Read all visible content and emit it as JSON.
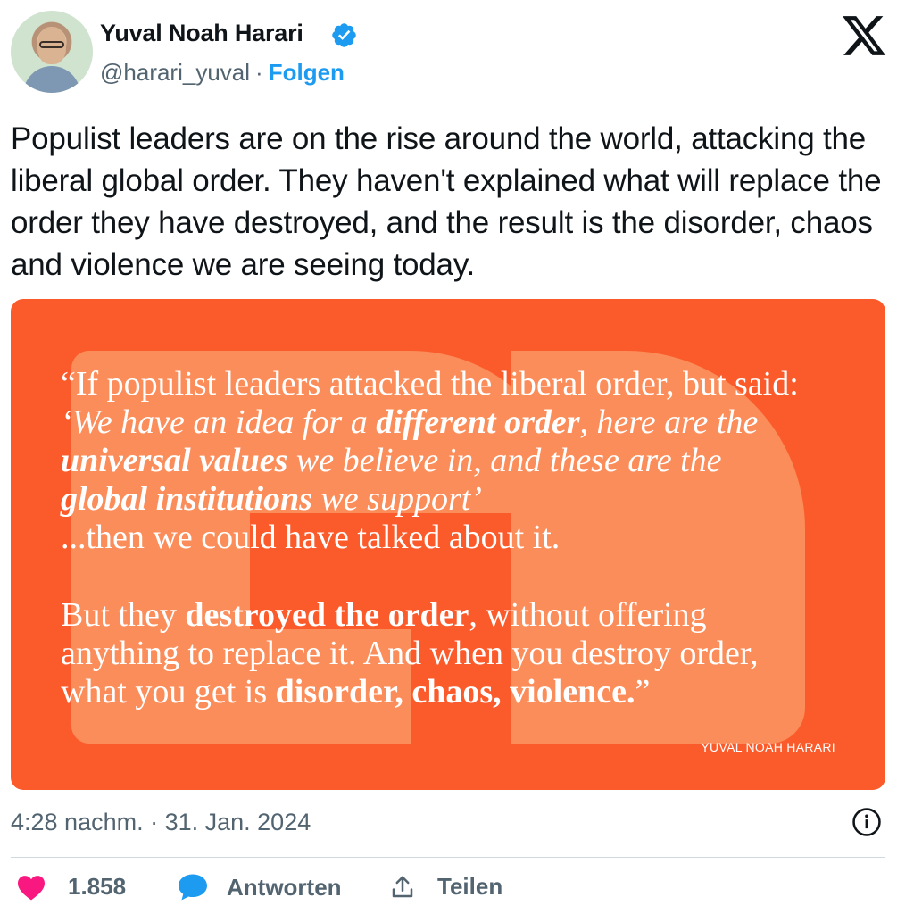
{
  "author": {
    "name": "Yuval Noah Harari",
    "handle": "@harari_yuval",
    "separator": "·",
    "follow_label": "Folgen"
  },
  "tweet": {
    "text": "Populist leaders are on the rise around the world, attacking the liberal global order. They haven't explained what will replace the order they have destroyed, and the result is the disorder, chaos and violence we are seeing today."
  },
  "quote_card": {
    "line1": "“If populist leaders attacked the liberal order, but said:",
    "line2_a": "‘We have an idea for a ",
    "line2_b": "different order",
    "line2_c": ", here are the",
    "line3_a": "universal values",
    "line3_b": " we believe in, and these are the",
    "line4_a": "global institutions",
    "line4_b": " we support’",
    "line5": "...then we could have talked about it.",
    "line6_a": "But they ",
    "line6_b": "destroyed the order",
    "line6_c": ", without offering",
    "line7": "anything to replace it. And when you destroy order,",
    "line8_a": "what you get is ",
    "line8_b": "disorder, chaos, violence.",
    "line8_c": "”",
    "attribution": "YUVAL NOAH HARARI",
    "background_color": "#fb5b2b"
  },
  "meta": {
    "timestamp": "4:28 nachm. · 31. Jan. 2024"
  },
  "actions": {
    "like_count": "1.858",
    "reply_label": "Antworten",
    "share_label": "Teilen"
  },
  "colors": {
    "accent": "#1d9bf0",
    "like": "#f91880",
    "secondary_text": "#536471"
  },
  "icons": [
    "verified-badge-icon",
    "x-logo-icon",
    "info-icon",
    "heart-icon",
    "reply-bubble-icon",
    "share-icon"
  ]
}
